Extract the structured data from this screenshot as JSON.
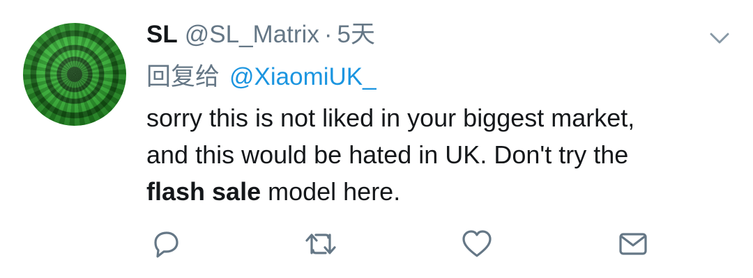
{
  "tweet": {
    "author": {
      "name": "SL",
      "handle": "@SL_Matrix",
      "separator": "·",
      "time": "5天"
    },
    "reply": {
      "prefix": "回复给",
      "to": "@XiaomiUK_"
    },
    "body": {
      "line1": "sorry this is not liked in your biggest market,",
      "line2": "and this would be hated in UK. Don't try the",
      "line3_bold": "flash sale",
      "line3_rest": " model here."
    },
    "icons": {
      "menu": "chevron-down-icon",
      "reply": "reply-icon",
      "retweet": "retweet-icon",
      "like": "heart-icon",
      "message": "envelope-icon"
    },
    "colors": {
      "text": "#14171a",
      "secondary": "#657786",
      "link": "#1b95e0",
      "icon": "#657786"
    }
  }
}
